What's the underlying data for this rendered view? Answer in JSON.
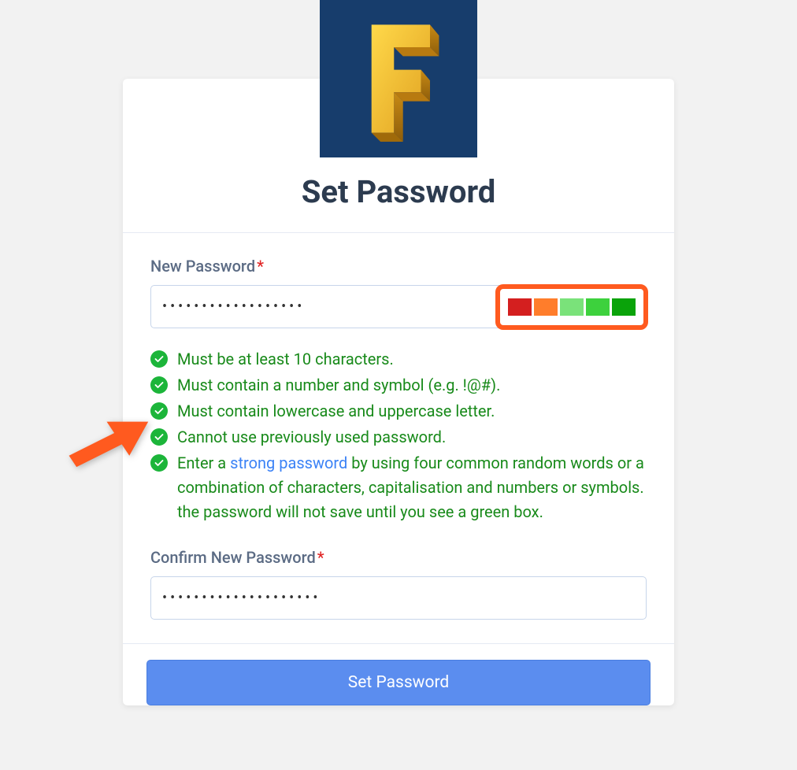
{
  "logo": {
    "letter": "F"
  },
  "header": {
    "title": "Set Password"
  },
  "fields": {
    "new_password": {
      "label": "New Password",
      "required_mark": "*",
      "value": "••••••••••••••••••"
    },
    "confirm_password": {
      "label": "Confirm New Password",
      "required_mark": "*",
      "value": "••••••••••••••••••••"
    }
  },
  "strength": {
    "colors": [
      "#d41f1f",
      "#ff7d2b",
      "#7ae27a",
      "#3dd13d",
      "#0aa30a"
    ]
  },
  "rules": [
    {
      "text": "Must be at least 10 characters."
    },
    {
      "text": "Must contain a number and symbol (e.g. !@#)."
    },
    {
      "text": "Must contain lowercase and uppercase letter."
    },
    {
      "text": "Cannot use previously used password."
    },
    {
      "prefix": "Enter a ",
      "link_text": "strong password",
      "suffix": " by using four common random words or a combination of characters, capitalisation and numbers or symbols. the password will not save until you see a green box."
    }
  ],
  "submit": {
    "label": "Set Password"
  }
}
